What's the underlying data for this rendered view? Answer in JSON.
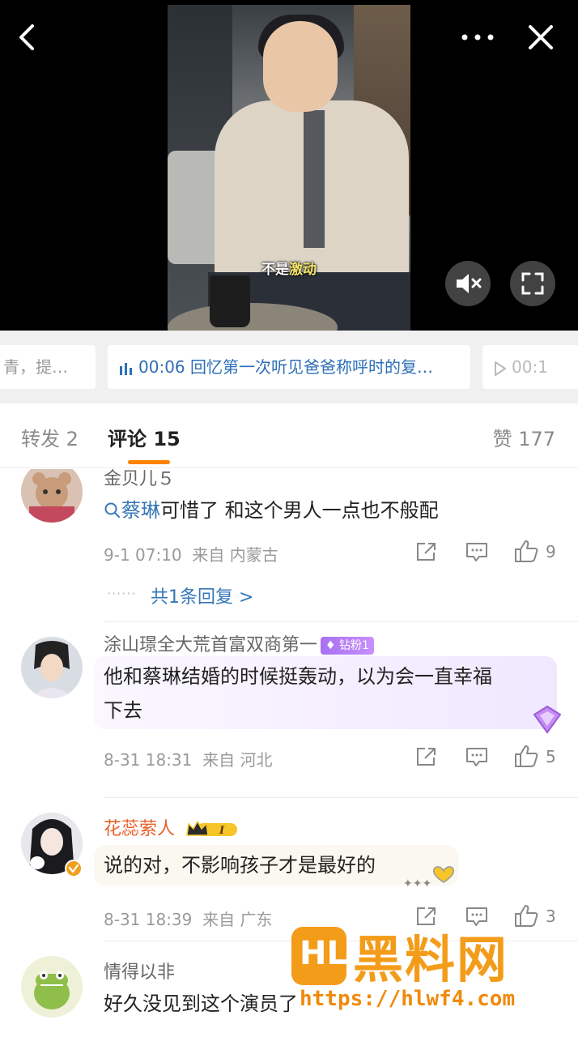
{
  "video": {
    "subtitle_white": "不是",
    "subtitle_yellow": "激动",
    "more_label": "···",
    "icons": {
      "back": "chevron-left-icon",
      "more": "more-horizontal-icon",
      "close": "close-icon",
      "mute": "volume-mute-icon",
      "fullscreen": "fullscreen-icon"
    }
  },
  "chapters": {
    "prev": "青，提…",
    "active_time": "00:06",
    "active_title": "回忆第一次听见爸爸称呼时的复…",
    "next_time": "00:1"
  },
  "tabs": {
    "repost": "转发 2",
    "comment": "评论 15",
    "like": "赞 177",
    "accent": "#ff8200"
  },
  "comments": [
    {
      "name": "金贝儿５",
      "mention": "蔡琳",
      "text": "可惜了 和这个男人一点也不般配",
      "time": "9-1 07:10",
      "location": "来自 内蒙古",
      "likes": "9",
      "replies": "共1条回复 >",
      "reply_dots": "······"
    },
    {
      "name": "涂山璟全大荒首富双商第一",
      "badge": "钻粉1",
      "text": "他和蔡琳结婚的时候挺轰动，以为会一直幸福下去",
      "text_line1": "他和蔡琳结婚的时候挺轰动，以为会一直幸福",
      "text_line2": "下去",
      "time": "8-31 18:31",
      "location": "来自 河北",
      "likes": "5"
    },
    {
      "name": "花蕊萦人",
      "level": "I",
      "text": "说的对，不影响孩子才是最好的",
      "time": "8-31 18:39",
      "location": "来自 广东",
      "likes": "3"
    },
    {
      "name": "情得以非",
      "text": "好久没见到这个演员了"
    }
  ],
  "watermark": {
    "logo": "HL",
    "title": "黑料网",
    "url": "https://hlwf4.com"
  }
}
